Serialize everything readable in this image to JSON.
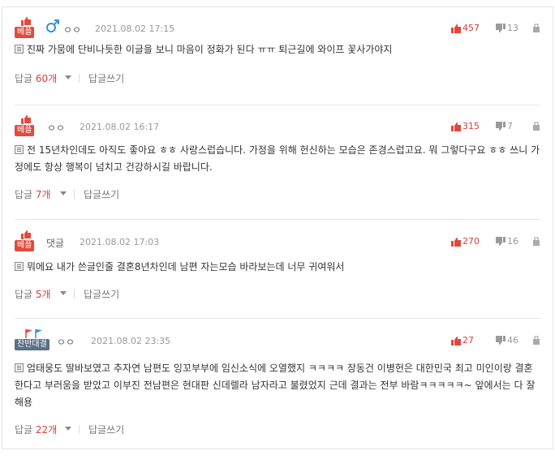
{
  "colors": {
    "accent": "#e14a3c",
    "upvote": "#d2403c",
    "muted": "#999999",
    "badge_alt": "#5b6f86"
  },
  "comments": [
    {
      "badge": "베플",
      "badge_icon": "thumbs-up-icon",
      "nick": "ㅇㅇ",
      "gender_icon": "male-symbol-icon",
      "date": "2021.08.02 17:15",
      "up": "457",
      "down": "13",
      "text": "진짜 가뭄에 단비나듯한 이글을 보니 마음이 정화가 된다 ㅠㅠ 퇴근길에 와이프 꽃사가야지",
      "reply_label": "답글",
      "reply_count": "60개",
      "write_label": "답글쓰기"
    },
    {
      "badge": "베플",
      "badge_icon": "thumbs-up-icon",
      "nick": "ㅇㅇ",
      "date": "2021.08.02 16:17",
      "up": "315",
      "down": "7",
      "text": "전 15년차인데도 아직도 좋아요 ㅎㅎ 사랑스럽습니다. 가정을 위해 헌신하는 모습은 존경스럽고요. 뭐 그렇다구요 ㅎㅎ 쓰니 가정에도 항상 행복이 넘치고 건강하시길 바랍니다.",
      "reply_label": "답글",
      "reply_count": "7개",
      "write_label": "답글쓰기"
    },
    {
      "badge": "베플",
      "badge_icon": "thumbs-up-icon",
      "nick": "댓글",
      "date": "2021.08.02 17:03",
      "up": "270",
      "down": "16",
      "text": "뭐에요 내가 쓴글인줄 결혼8년차인데 남편 자는모습 바라보는데 너무 귀여워서",
      "reply_label": "답글",
      "reply_count": "5개",
      "write_label": "답글쓰기"
    },
    {
      "badge": "찬반대결",
      "badge_icon": "flags-icon",
      "nick": "ㅇㅇ",
      "date": "2021.08.02 23:35",
      "up": "27",
      "down": "46",
      "text": "엄태웅도 딸바보였고 추자연 남편도 잉꼬부부에 임신소식에 오열했지 ㅋㅋㅋㅋ 장동건 이병헌은 대한민국 최고 미인이랑 결혼한다고 부러움을 받았고 이부진 전남편은 현대판 신데렐라 남자라고 불렸었지 근데 결과는 전부 바람ㅋㅋㅋㅋㅋ~ 앞에서는 다 잘해용",
      "reply_label": "답글",
      "reply_count": "22개",
      "write_label": "답글쓰기"
    }
  ]
}
